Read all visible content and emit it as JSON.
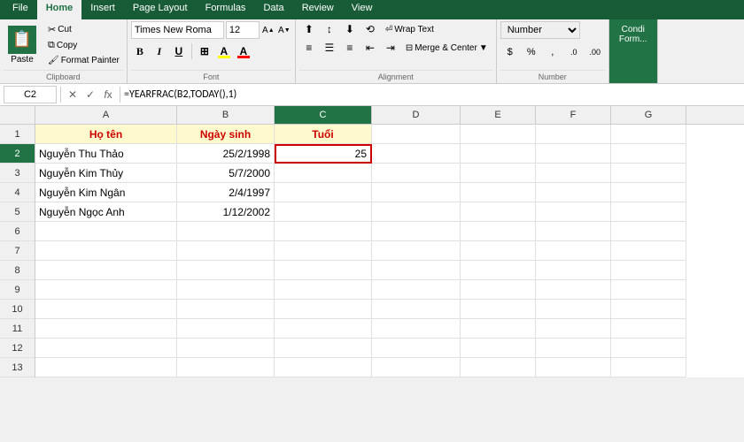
{
  "ribbon": {
    "tabs": [
      "File",
      "Home",
      "Insert",
      "Page Layout",
      "Formulas",
      "Data",
      "Review",
      "View"
    ],
    "active_tab": "Home",
    "clipboard": {
      "paste_label": "Paste",
      "cut_label": "Cut",
      "copy_label": "Copy",
      "format_painter_label": "Format Painter",
      "group_label": "Clipboard"
    },
    "font": {
      "name": "Times New Roma",
      "size": "12",
      "bold": "B",
      "italic": "I",
      "underline": "U",
      "group_label": "Font"
    },
    "alignment": {
      "wrap_text": "Wrap Text",
      "merge_center": "Merge & Center",
      "group_label": "Alignment"
    },
    "number": {
      "format": "Number",
      "dollar": "$",
      "percent": "%",
      "comma": ",",
      "increase_decimal": ".0",
      "decrease_decimal": ".00",
      "group_label": "Number"
    },
    "continue_label": "Condi\nForm..."
  },
  "formula_bar": {
    "cell_ref": "C2",
    "formula": "=YEARFRAC(B2,TODAY(),1)"
  },
  "columns": {
    "headers": [
      "A",
      "B",
      "C",
      "D",
      "E",
      "F",
      "G"
    ],
    "row_numbers": [
      "1",
      "2",
      "3",
      "4",
      "5",
      "6",
      "7",
      "8",
      "9",
      "10",
      "11",
      "12",
      "13"
    ]
  },
  "cells": {
    "row1": {
      "a": "Họ tên",
      "b": "Ngày sinh",
      "c": "Tuổi",
      "d": "",
      "e": "",
      "f": "",
      "g": ""
    },
    "row2": {
      "a": "Nguyễn Thu Thảo",
      "b": "25/2/1998",
      "c": "25",
      "d": "",
      "e": "",
      "f": "",
      "g": ""
    },
    "row3": {
      "a": "Nguyễn Kim Thủy",
      "b": "5/7/2000",
      "c": "",
      "d": "",
      "e": "",
      "f": "",
      "g": ""
    },
    "row4": {
      "a": "Nguyễn Kim Ngân",
      "b": "2/4/1997",
      "c": "",
      "d": "",
      "e": "",
      "f": "",
      "g": ""
    },
    "row5": {
      "a": "Nguyễn Ngọc Anh",
      "b": "1/12/2002",
      "c": "",
      "d": "",
      "e": "",
      "f": "",
      "g": ""
    }
  }
}
